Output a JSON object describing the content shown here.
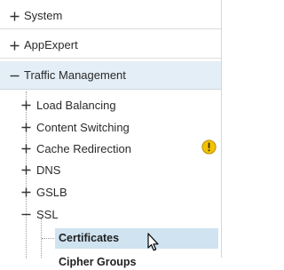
{
  "nav": {
    "top_items": [
      {
        "label": "System",
        "state": "collapsed"
      },
      {
        "label": "AppExpert",
        "state": "collapsed"
      },
      {
        "label": "Traffic Management",
        "state": "expanded"
      }
    ],
    "traffic_children": [
      {
        "label": "Load Balancing",
        "state": "collapsed"
      },
      {
        "label": "Content Switching",
        "state": "collapsed"
      },
      {
        "label": "Cache Redirection",
        "state": "collapsed",
        "badge": "warning-icon"
      },
      {
        "label": "DNS",
        "state": "collapsed"
      },
      {
        "label": "GSLB",
        "state": "collapsed"
      },
      {
        "label": "SSL",
        "state": "expanded"
      }
    ],
    "ssl_children": [
      {
        "label": "Certificates",
        "state": "selected"
      },
      {
        "label": "Cipher Groups",
        "state": "partially-visible"
      }
    ]
  },
  "colors": {
    "expanded_row_bg": "#e3eef6",
    "selected_row_bg": "#cfe3f0",
    "warning_badge": "#f2c200",
    "text": "#2b2b2b"
  },
  "icons": {
    "collapsed": "plus-icon",
    "expanded": "minus-icon",
    "warning": "warning-icon",
    "cursor": "mouse-pointer-icon"
  }
}
